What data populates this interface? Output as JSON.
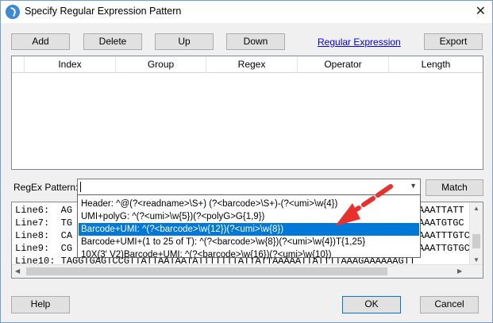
{
  "window": {
    "title": "Specify Regular Expression Pattern",
    "close_glyph": "✕"
  },
  "toolbar": {
    "add": "Add",
    "delete": "Delete",
    "up": "Up",
    "down": "Down",
    "link": "Regular Expression",
    "export": "Export"
  },
  "grid": {
    "columns": [
      "Index",
      "Group",
      "Regex",
      "Operator",
      "Length"
    ]
  },
  "regex": {
    "label": "RegEx Pattern:",
    "value": "",
    "match": "Match"
  },
  "dropdown": {
    "items": [
      "Header: ^@(?<readname>\\S+) (?<barcode>\\S+)-(?<umi>\\w{4})",
      "UMI+polyG: ^(?<umi>\\w{5})(?<polyG>G{1,9})",
      "Barcode+UMI: ^(?<barcode>\\w{12})(?<umi>\\w{8})",
      "Barcode+UMI+(1 to 25 of T): ^(?<barcode>\\w{8})(?<umi>\\w{4})T{1,25}",
      "10X(3' V2)Barcode+UMI: ^(?<barcode>\\w{16})(?<umi>\\w{10})"
    ],
    "selected_index": 2
  },
  "lines": [
    {
      "label": "Line6:",
      "left": "AG",
      "right": "AAATTATT"
    },
    {
      "label": "Line7:",
      "left": "TG",
      "right": "AAATGTGC"
    },
    {
      "label": "Line8:",
      "left": "CA",
      "right": "AAATTTGTC"
    },
    {
      "label": "Line9:",
      "left": "CG",
      "right": "AAATTGTGC"
    },
    {
      "label": "Line10:",
      "left": "TAGGTGAGTCCGTTATTAATAATATTTTTTTATTATTAAAAATTATTTTAAAGAAAAAAGTT",
      "right": ""
    }
  ],
  "footer": {
    "help": "Help",
    "ok": "OK",
    "cancel": "Cancel"
  },
  "colors": {
    "selection": "#0078d7",
    "arrow": "#e8312c",
    "link": "#0000ee"
  }
}
